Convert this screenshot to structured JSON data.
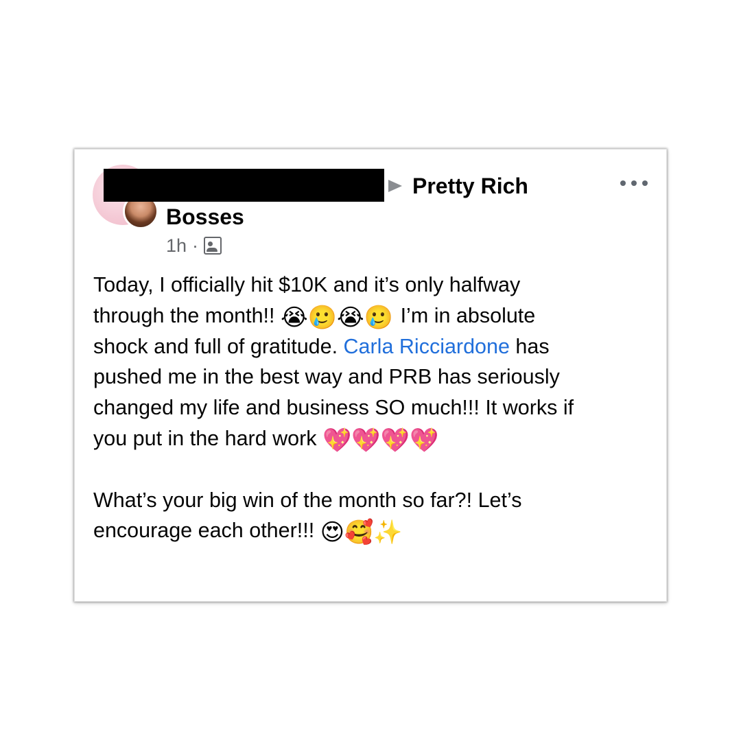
{
  "post": {
    "group_name_part1": "Pretty Rich",
    "group_name_part2": "Bosses",
    "timestamp": "1h",
    "separator": "·",
    "privacy_icon": "group-members-icon",
    "lines": [
      {
        "before": "Today, I officially hit $10K and it’s only halfway"
      },
      {
        "before": "through the month!! ",
        "emojis": "😭🥲😭🥲",
        "after": " I’m in absolute"
      },
      {
        "before": "shock and full of gratitude. ",
        "mention": "Carla Ricciardone",
        "after": " has"
      },
      {
        "before": "pushed me in the best way and PRB has seriously"
      },
      {
        "before": "changed my life and business SO much!!! It works if"
      },
      {
        "before": "you put in the hard work ",
        "emojis": "💖💖💖💖"
      },
      {
        "before": "What’s your big win of the month so far?! Let’s"
      },
      {
        "before": "encourage each other!!! ",
        "emojis": "😍🥰✨"
      }
    ]
  },
  "colors": {
    "mention": "#216fdb",
    "meta_text": "#65676b",
    "arrow": "#8a8d91",
    "redaction": "#000000"
  }
}
